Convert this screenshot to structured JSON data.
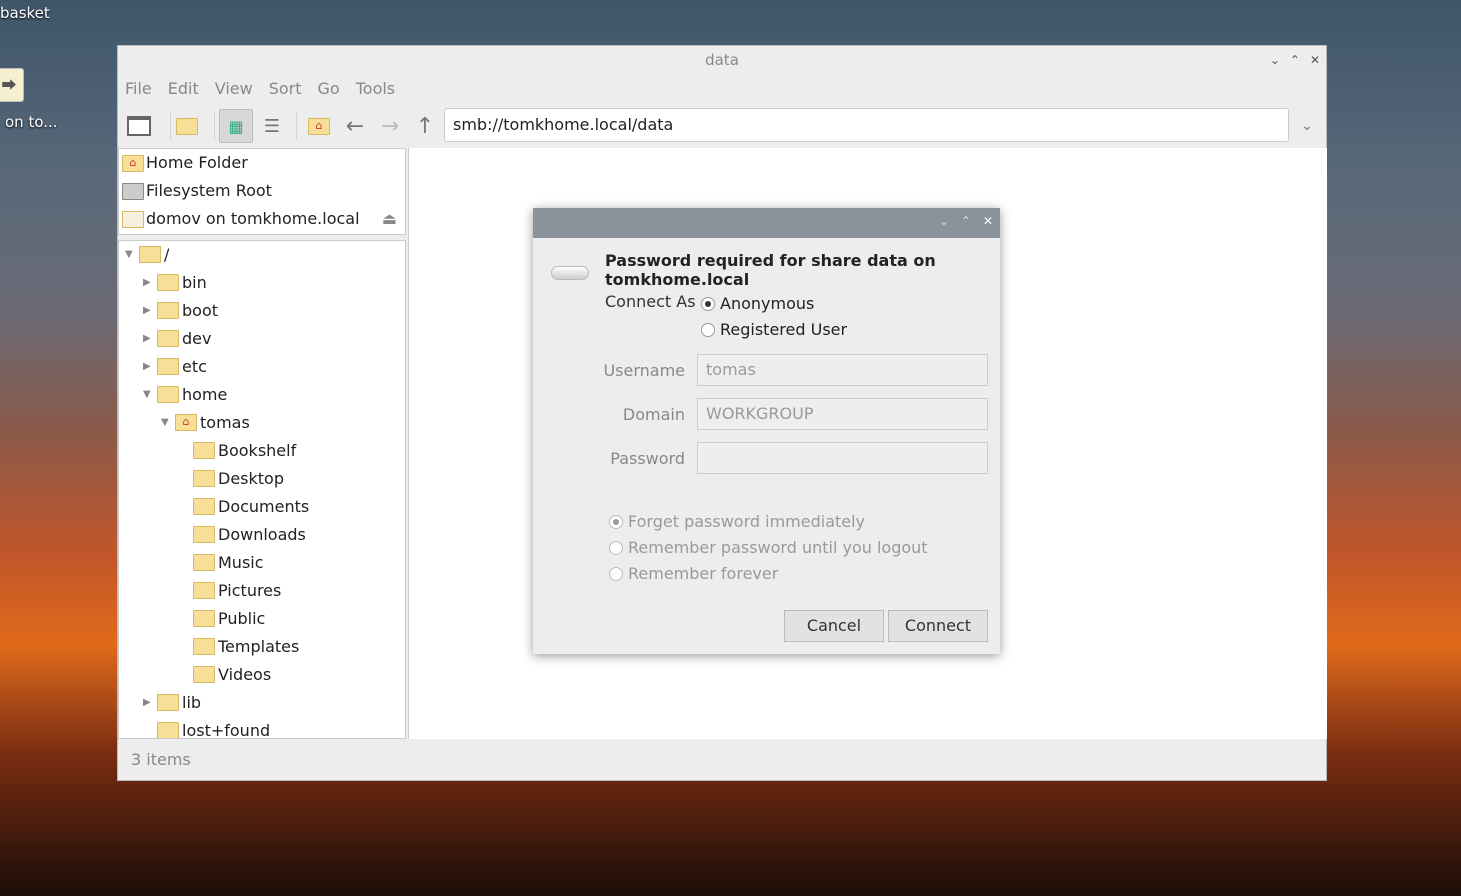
{
  "desktop": {
    "item1_label": "basket",
    "item2_label": "on to..."
  },
  "window": {
    "title": "data",
    "menu": [
      "File",
      "Edit",
      "View",
      "Sort",
      "Go",
      "Tools"
    ],
    "address": "smb://tomkhome.local/data",
    "status": "3 items"
  },
  "places": [
    {
      "label": "Home Folder",
      "icon": "home-folder-icon"
    },
    {
      "label": "Filesystem Root",
      "icon": "drive-icon"
    },
    {
      "label": "domov on tomkhome.local",
      "icon": "network-folder-icon"
    }
  ],
  "tree": [
    {
      "label": "/",
      "level": 0,
      "expanded": true
    },
    {
      "label": "bin",
      "level": 1,
      "expanded": false
    },
    {
      "label": "boot",
      "level": 1,
      "expanded": false
    },
    {
      "label": "dev",
      "level": 1,
      "expanded": false
    },
    {
      "label": "etc",
      "level": 1,
      "expanded": false
    },
    {
      "label": "home",
      "level": 1,
      "expanded": true
    },
    {
      "label": "tomas",
      "level": 2,
      "expanded": true,
      "home": true
    },
    {
      "label": "Bookshelf",
      "level": 3
    },
    {
      "label": "Desktop",
      "level": 3
    },
    {
      "label": "Documents",
      "level": 3
    },
    {
      "label": "Downloads",
      "level": 3
    },
    {
      "label": "Music",
      "level": 3
    },
    {
      "label": "Pictures",
      "level": 3
    },
    {
      "label": "Public",
      "level": 3
    },
    {
      "label": "Templates",
      "level": 3
    },
    {
      "label": "Videos",
      "level": 3
    },
    {
      "label": "lib",
      "level": 1,
      "expanded": false
    },
    {
      "label": "lost+found",
      "level": 1
    }
  ],
  "dialog": {
    "heading": "Password required for share data on tomkhome.local",
    "connect_as_label": "Connect As",
    "connect_options": [
      {
        "label": "Anonymous",
        "selected": true
      },
      {
        "label": "Registered User",
        "selected": false
      }
    ],
    "username_label": "Username",
    "username_value": "tomas",
    "domain_label": "Domain",
    "domain_value": "WORKGROUP",
    "password_label": "Password",
    "password_value": "",
    "remember_options": [
      {
        "label": "Forget password immediately",
        "selected": true
      },
      {
        "label": "Remember password until you logout",
        "selected": false
      },
      {
        "label": "Remember forever",
        "selected": false
      }
    ],
    "cancel": "Cancel",
    "connect": "Connect"
  }
}
